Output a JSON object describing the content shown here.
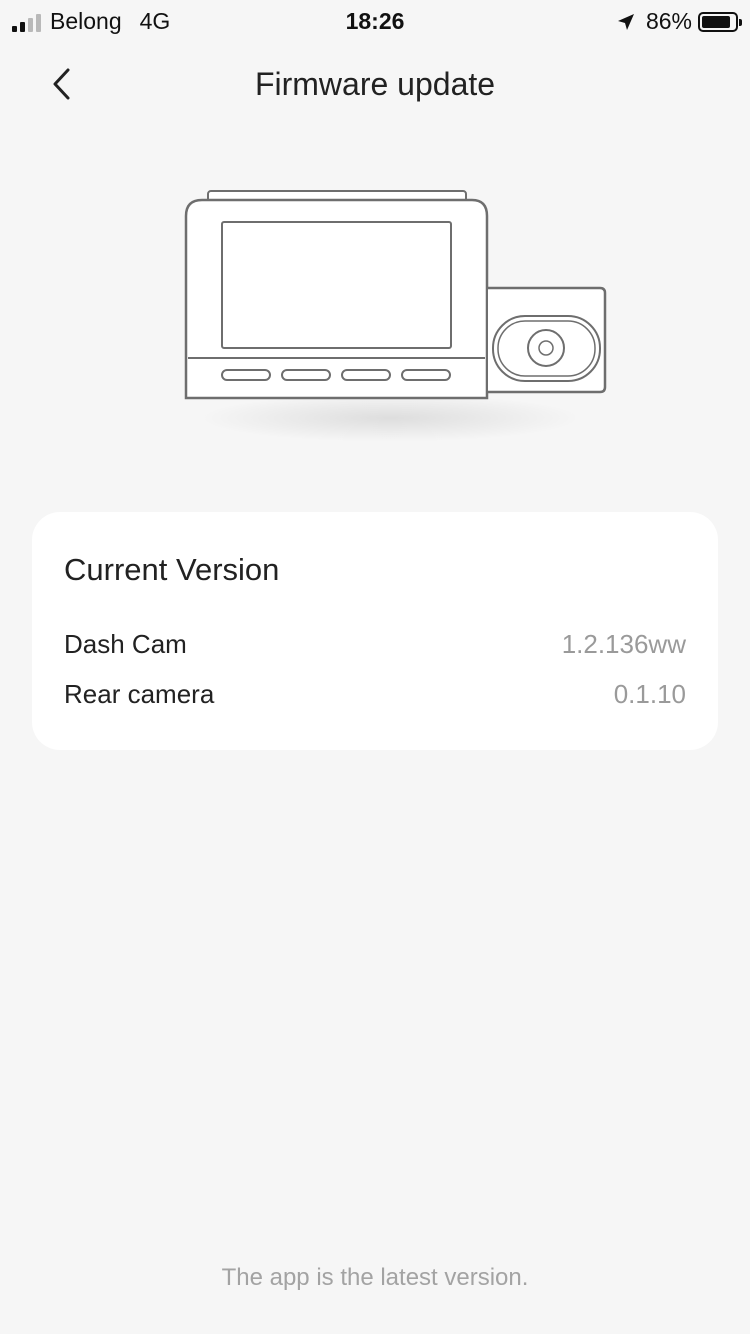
{
  "status_bar": {
    "carrier": "Belong",
    "network": "4G",
    "time": "18:26",
    "battery_percent": "86%",
    "battery_level": 0.86
  },
  "nav": {
    "title": "Firmware update",
    "back_icon": "chevron-left-icon"
  },
  "illustration": {
    "name": "dash-cam-with-rear-camera"
  },
  "current_version": {
    "title": "Current Version",
    "rows": [
      {
        "label": "Dash Cam",
        "value": "1.2.136ww"
      },
      {
        "label": "Rear camera",
        "value": "0.1.10"
      }
    ]
  },
  "footer": {
    "note": "The app is the latest version."
  }
}
